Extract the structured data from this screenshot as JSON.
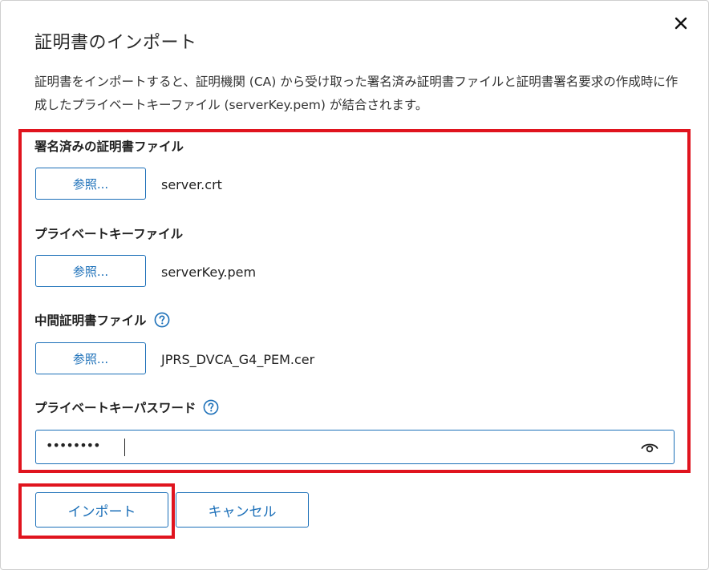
{
  "dialog": {
    "title": "証明書のインポート",
    "description": "証明書をインポートすると、証明機関 (CA) から受け取った署名済み証明書ファイルと証明書署名要求の作成時に作成したプライベートキーファイル (serverKey.pem) が結合されます。",
    "close_icon": "close-icon"
  },
  "fields": {
    "signed_cert": {
      "label": "署名済みの証明書ファイル",
      "browse_label": "参照...",
      "file": "server.crt"
    },
    "private_key": {
      "label": "プライベートキーファイル",
      "browse_label": "参照...",
      "file": "serverKey.pem"
    },
    "intermediate_cert": {
      "label": "中間証明書ファイル",
      "help_icon": "help-icon",
      "browse_label": "参照...",
      "file": "JPRS_DVCA_G4_PEM.cer"
    },
    "password": {
      "label": "プライベートキーパスワード",
      "help_icon": "help-icon",
      "value": "••••••••",
      "reveal_icon": "eye-icon"
    }
  },
  "actions": {
    "import_label": "インポート",
    "cancel_label": "キャンセル"
  },
  "colors": {
    "accent": "#1b6fb8",
    "highlight": "#e0141e",
    "text": "#222222",
    "border": "#cfcfcf"
  }
}
